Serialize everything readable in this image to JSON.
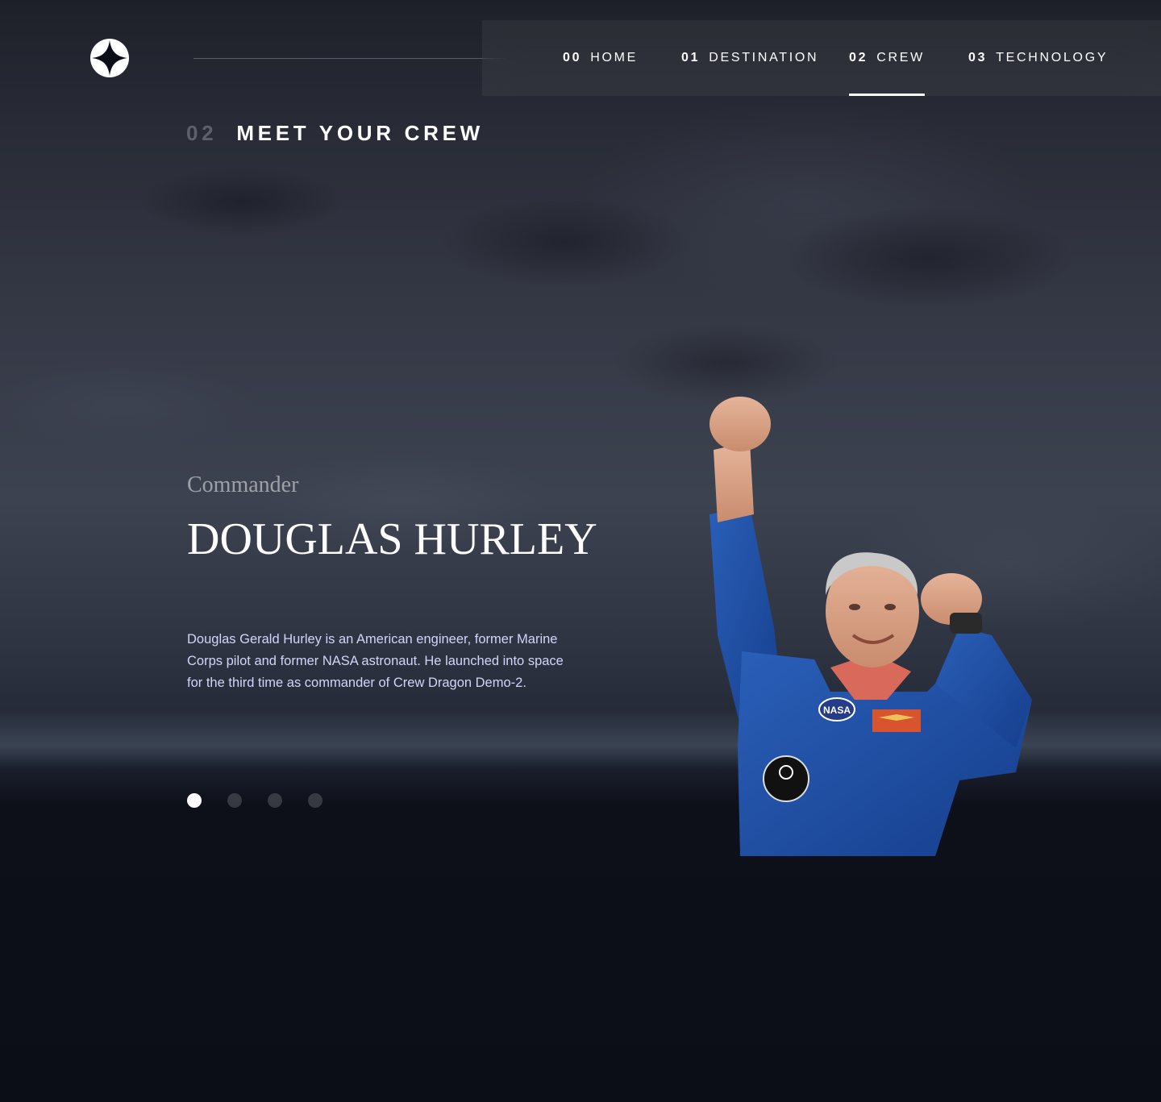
{
  "header": {
    "logo_icon": "star-logo-icon",
    "nav": [
      {
        "num": "00",
        "label": "HOME",
        "active": false
      },
      {
        "num": "01",
        "label": "DESTINATION",
        "active": false
      },
      {
        "num": "02",
        "label": "CREW",
        "active": true
      },
      {
        "num": "03",
        "label": "TECHNOLOGY",
        "active": false
      }
    ]
  },
  "section": {
    "num": "02",
    "title": "MEET YOUR CREW"
  },
  "crew": {
    "role": "Commander",
    "name": "DOUGLAS HURLEY",
    "bio": "Douglas Gerald Hurley is an American engineer, former Marine Corps pilot and former NASA astronaut. He launched into space for the third time as commander of Crew Dragon Demo-2.",
    "selected_index": 0,
    "total": 4
  },
  "image": {
    "icon": "astronaut-photo",
    "patch_text": "NASA"
  },
  "colors": {
    "background": "#0b0d17",
    "text": "#ffffff",
    "body_text": "#d0d6f9"
  }
}
